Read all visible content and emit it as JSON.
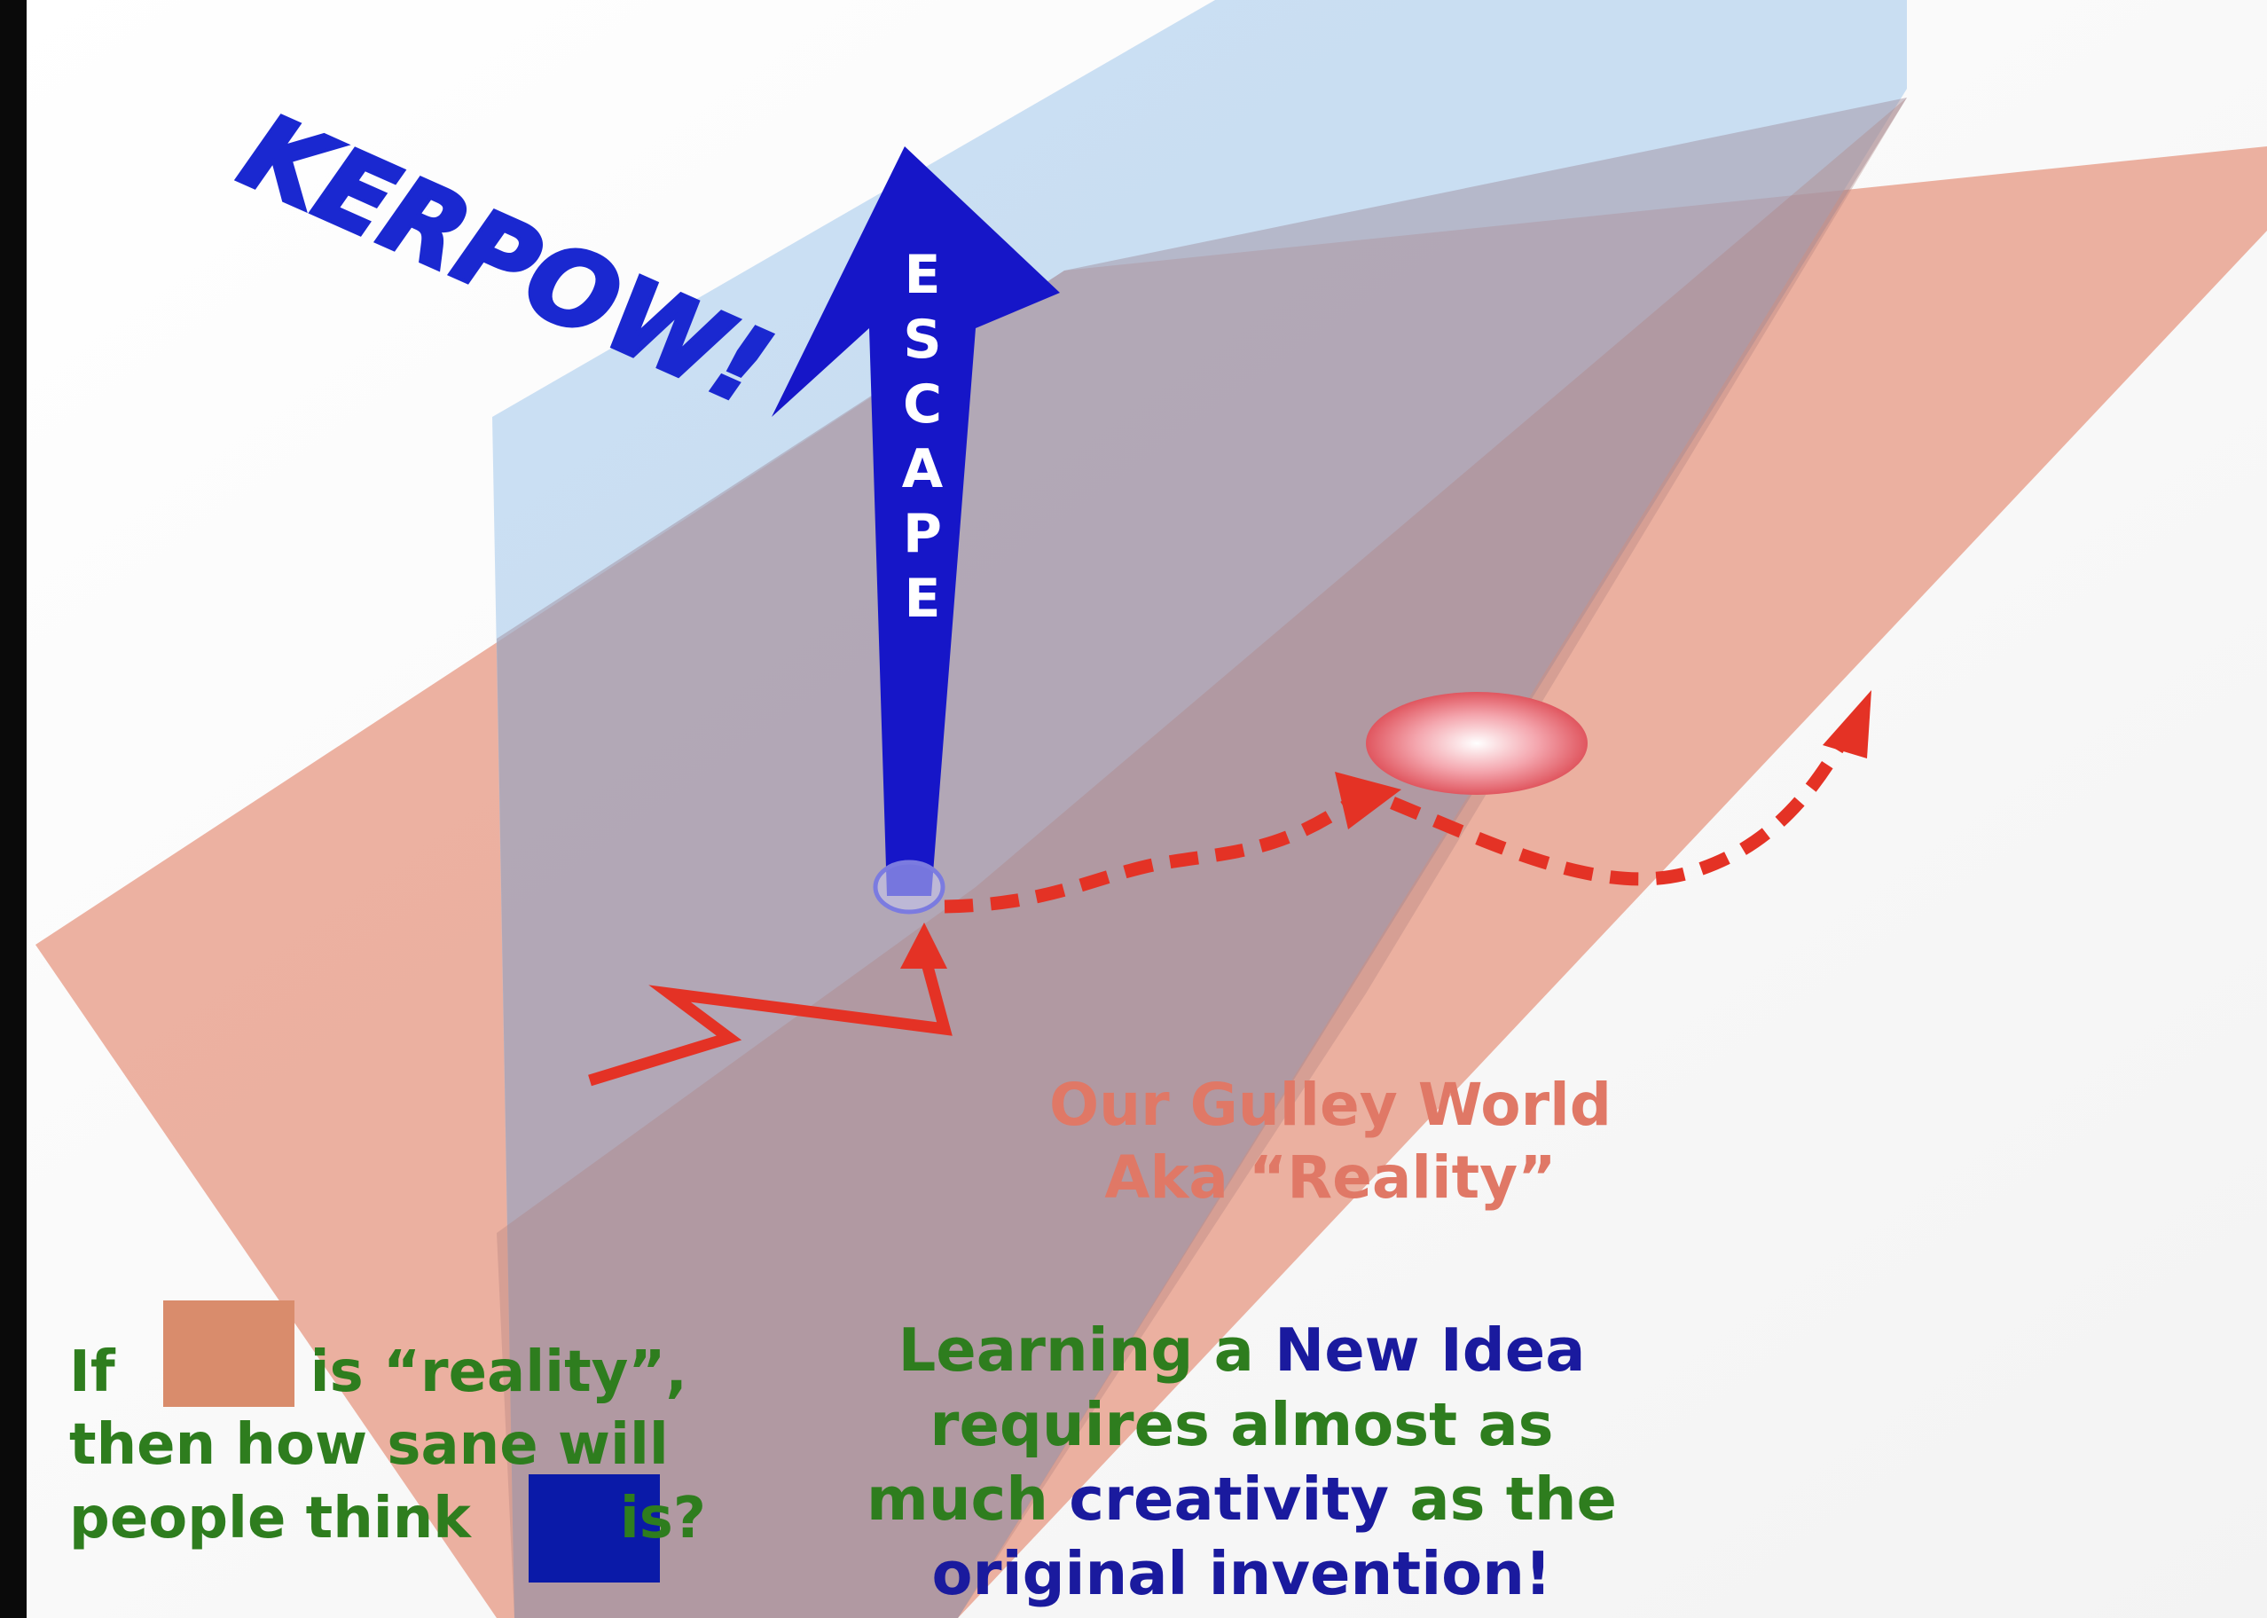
{
  "arrow": {
    "label": "ESCAPE"
  },
  "exclamation": {
    "text": "KERPOW!"
  },
  "world": {
    "line1": "Our Gulley World",
    "line2": "Aka “Reality”"
  },
  "sane_question": {
    "line1_prefix": "If",
    "line1_suffix": "is “reality”,",
    "line2": "then how sane will",
    "line3_prefix": "people think",
    "line3_suffix": "is?"
  },
  "learning": {
    "line1_a": "Learning a ",
    "line1_b": "New Idea",
    "line2": "requires almost as",
    "line3_a": "much ",
    "line3_b": "creativity",
    "line3_c": " as the",
    "line4": "original invention!"
  },
  "colors": {
    "reality_plane": "#e8a08c",
    "new_idea_plane": "#a9cbed",
    "escape_arrow": "#1616c8",
    "path_red": "#e43225",
    "text_green": "#2e7d1e",
    "text_blue": "#1a1a9e",
    "caption_orange": "#e07866"
  }
}
